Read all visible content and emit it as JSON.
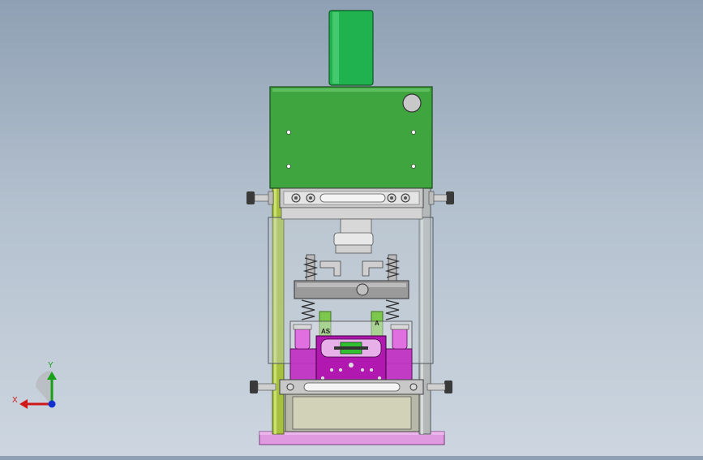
{
  "triad": {
    "x_label": "X",
    "y_label": "Y",
    "x_color": "#d01818",
    "y_color": "#18a018",
    "z_color": "#1030d0"
  },
  "part_labels": {
    "block_left": "AS",
    "block_right": "A"
  },
  "colors": {
    "motor": "#20b050",
    "housing": "#3fa63f",
    "magenta": "#c020c0",
    "base_plate": "#e090e0",
    "column": "#a8c040",
    "steel": "#b0b0b0"
  },
  "icons": [
    "axis-triad-icon"
  ]
}
